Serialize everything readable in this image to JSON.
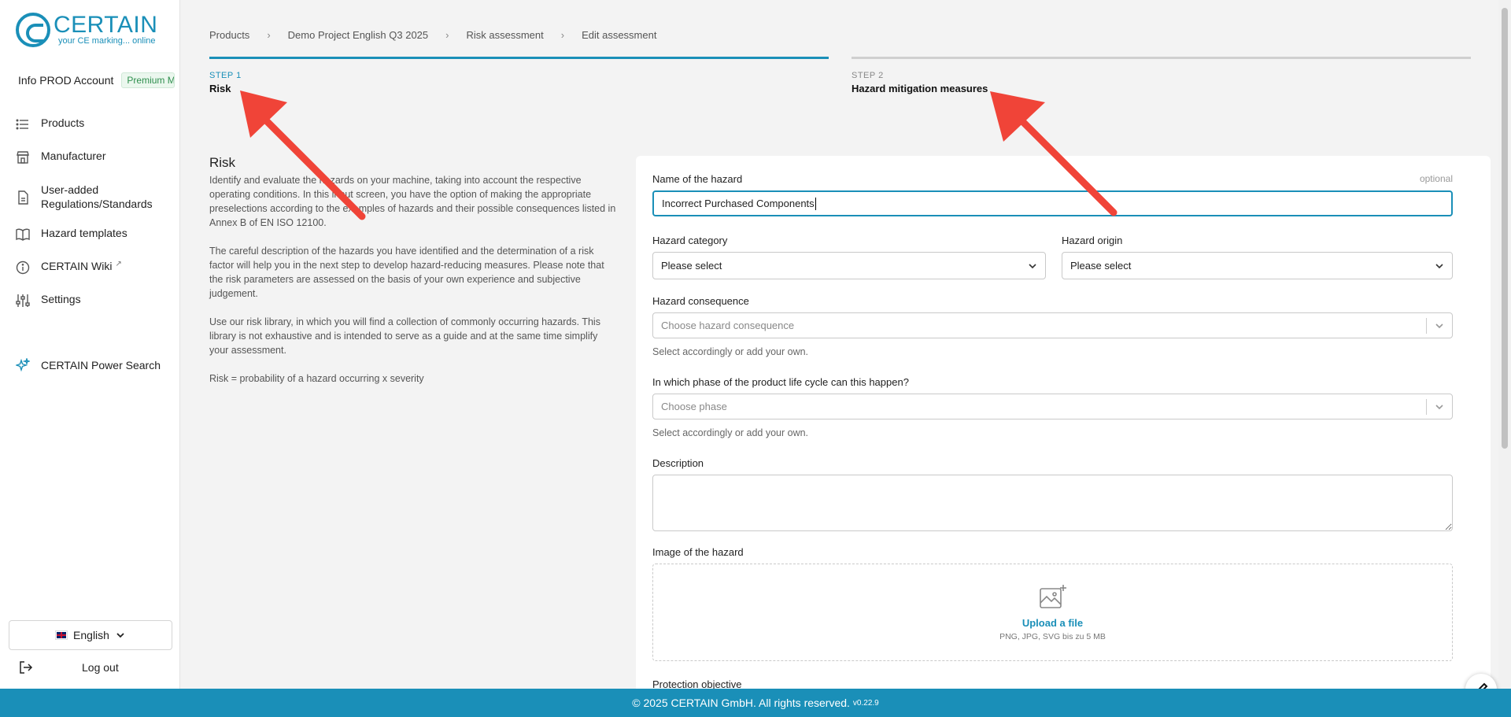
{
  "brand": {
    "name": "CERTAIN",
    "tagline": "your CE marking... online"
  },
  "account": {
    "name": "Info PROD Account",
    "plan": "Premium M"
  },
  "sidebar": {
    "items": [
      {
        "label": "Products",
        "icon": "list-icon"
      },
      {
        "label": "Manufacturer",
        "icon": "store-icon"
      },
      {
        "label": "User-added Regulations/Standards",
        "icon": "document-icon"
      },
      {
        "label": "Hazard templates",
        "icon": "book-icon"
      },
      {
        "label": "CERTAIN Wiki",
        "icon": "info-icon",
        "external_icon": "external-link-icon"
      },
      {
        "label": "Settings",
        "icon": "sliders-icon"
      }
    ],
    "power_search": "CERTAIN Power Search",
    "language": "English",
    "logout": "Log out"
  },
  "breadcrumb": [
    "Products",
    "Demo Project English Q3 2025",
    "Risk assessment",
    "Edit assessment"
  ],
  "steps": [
    {
      "num": "STEP 1",
      "title": "Risk",
      "active": true
    },
    {
      "num": "STEP 2",
      "title": "Hazard mitigation measures",
      "active": false
    }
  ],
  "intro": {
    "heading": "Risk",
    "p1": "Identify and evaluate the hazards on your machine, taking into account the respective operating conditions. In this input screen, you have the option of making the appropriate preselections according to the examples of hazards and their possible consequences listed in Annex B of EN ISO 12100.",
    "p2": "The careful description of the hazards you have identified and the determination of a risk factor will help you in the next step to develop hazard-reducing measures. Please note that the risk parameters are assessed on the basis of your own experience and subjective judgement.",
    "p3": "Use our risk library, in which you will find a collection of commonly occurring hazards. This library is not exhaustive and is intended to serve as a guide and at the same time simplify your assessment.",
    "p4": "Risk = probability of a hazard occurring x severity"
  },
  "form": {
    "name_label": "Name of the hazard",
    "name_optional": "optional",
    "name_value": "Incorrect Purchased Components",
    "category_label": "Hazard category",
    "category_value": "Please select",
    "origin_label": "Hazard origin",
    "origin_value": "Please select",
    "consequence_label": "Hazard consequence",
    "consequence_placeholder": "Choose hazard consequence",
    "consequence_hint": "Select accordingly or add your own.",
    "phase_label": "In which phase of the product life cycle can this happen?",
    "phase_placeholder": "Choose phase",
    "phase_hint": "Select accordingly or add your own.",
    "description_label": "Description",
    "image_label": "Image of the hazard",
    "upload_link": "Upload a file",
    "upload_hint": "PNG, JPG, SVG bis zu 5 MB",
    "protection_label": "Protection objective"
  },
  "footer": {
    "text": "© 2025 CERTAIN GmbH. All rights reserved.",
    "version": "v0.22.9"
  },
  "colors": {
    "accent": "#1a8fb8",
    "annotation_arrow": "#f04438"
  }
}
